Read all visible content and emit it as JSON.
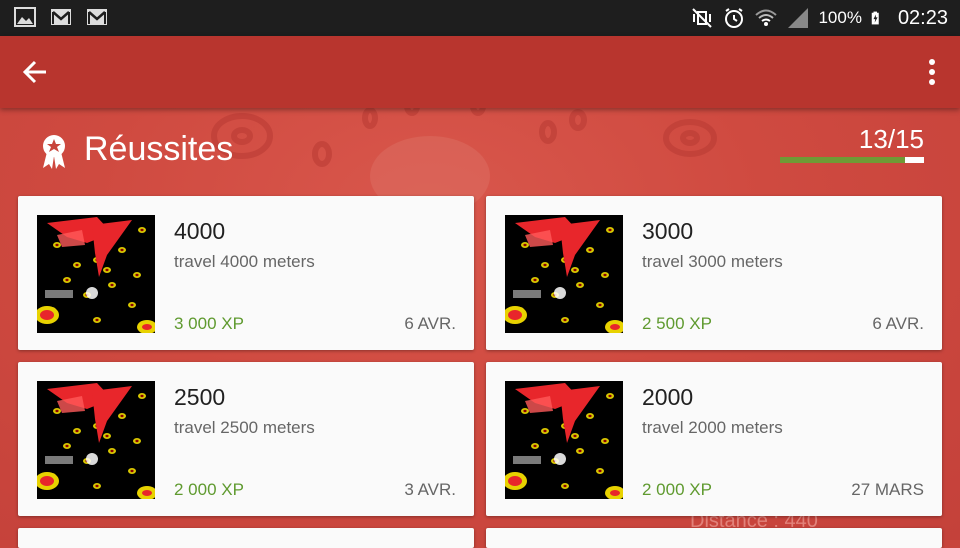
{
  "status_bar": {
    "left_icons": [
      "gallery-icon",
      "gmail-icon",
      "gmail-icon"
    ],
    "battery_text": "100%",
    "time": "02:23"
  },
  "app_bar": {
    "back_icon": "arrow-back-icon",
    "menu_icon": "more-vertical-icon"
  },
  "header": {
    "title": "Réussites",
    "progress_text": "13/15",
    "progress": {
      "completed": 13,
      "total": 15
    }
  },
  "achievements": [
    {
      "title": "4000",
      "description": "travel 4000 meters",
      "xp": "3 000 XP",
      "date": "6 AVR."
    },
    {
      "title": "3000",
      "description": "travel 3000 meters",
      "xp": "2 500 XP",
      "date": "6 AVR."
    },
    {
      "title": "2500",
      "description": "travel 2500 meters",
      "xp": "2 000 XP",
      "date": "3 AVR."
    },
    {
      "title": "2000",
      "description": "travel 2000 meters",
      "xp": "2 000 XP",
      "date": "27 MARS"
    }
  ],
  "background_text": "Distance : 440",
  "colors": {
    "app_bar": "#b8352e",
    "background": "#c8453c",
    "xp_green": "#5f9a2f",
    "progress_fill": "#6f9a35"
  }
}
